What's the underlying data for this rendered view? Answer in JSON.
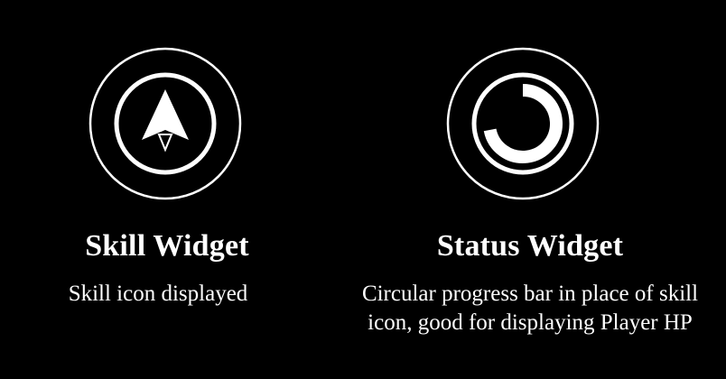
{
  "widgets": {
    "skill": {
      "title": "Skill Widget",
      "description": [
        "Skill icon displayed"
      ],
      "icon": "arrow-skill-icon"
    },
    "status": {
      "title": "Status Widget",
      "description": [
        "Circular progress bar in place of skill",
        "icon, good for displaying Player HP"
      ],
      "icon": "circular-progress-icon",
      "progress": 0.72
    }
  },
  "colors": {
    "background": "#000000",
    "foreground": "#ffffff"
  }
}
